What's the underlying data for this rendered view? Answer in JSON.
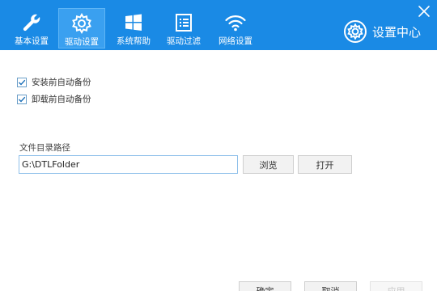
{
  "tabs": [
    {
      "label": "基本设置",
      "icon": "wrench-icon"
    },
    {
      "label": "驱动设置",
      "icon": "gear-icon"
    },
    {
      "label": "系统帮助",
      "icon": "windows-icon"
    },
    {
      "label": "驱动过滤",
      "icon": "list-icon"
    },
    {
      "label": "网络设置",
      "icon": "wifi-icon"
    }
  ],
  "active_tab": "驱动设置",
  "brand": {
    "label": "设置中心",
    "icon": "settings-gear-icon"
  },
  "options": [
    {
      "label": "安装前自动备份",
      "checked": true
    },
    {
      "label": "卸载前自动备份",
      "checked": true
    }
  ],
  "path": {
    "label": "文件目录路径",
    "value": "G:\\DTLFolder",
    "browse_label": "浏览",
    "open_label": "打开"
  },
  "footer": {
    "ok_label": "确定",
    "cancel_label": "取消",
    "apply_label": "应用"
  },
  "colors": {
    "header": "#1a8ae5",
    "active_tab": "#3aa0f0",
    "accent": "#1a8ae5"
  }
}
